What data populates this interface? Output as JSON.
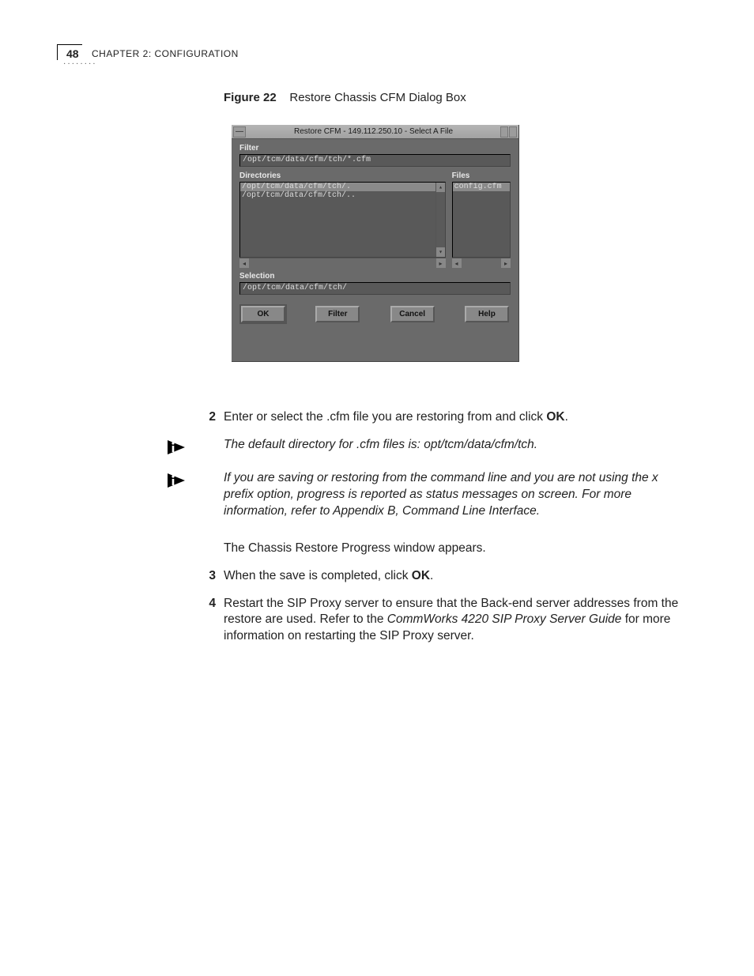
{
  "header": {
    "page_number": "48",
    "chapter_text": "CHAPTER 2: CONFIGURATION"
  },
  "figure": {
    "label": "Figure 22",
    "caption": "Restore Chassis CFM Dialog Box"
  },
  "dialog": {
    "title": "Restore CFM - 149.112.250.10 - Select A File",
    "filter_label": "Filter",
    "filter_value": "/opt/tcm/data/cfm/tch/*.cfm",
    "directories_label": "Directories",
    "directories": [
      "/opt/tcm/data/cfm/tch/.",
      "/opt/tcm/data/cfm/tch/.."
    ],
    "files_label": "Files",
    "files": [
      "config.cfm"
    ],
    "selection_label": "Selection",
    "selection_value": "/opt/tcm/data/cfm/tch/",
    "buttons": {
      "ok": "OK",
      "filter": "Filter",
      "cancel": "Cancel",
      "help": "Help"
    }
  },
  "steps": {
    "s2_num": "2",
    "s2_pre": "Enter or select the .cfm file you are restoring from and click ",
    "s2_bold": "OK",
    "s2_post": ".",
    "note1": "The default directory for .cfm files is: opt/tcm/data/cfm/tch.",
    "note2": "If you are saving or restoring from the command line and you are not using the x prefix option, progress is reported as status messages on screen. For more information, refer to Appendix B, Command Line Interface.",
    "progress": "The Chassis Restore Progress window appears.",
    "s3_num": "3",
    "s3_pre": "When the save is completed, click ",
    "s3_bold": "OK",
    "s3_post": ".",
    "s4_num": "4",
    "s4_pre": "Restart the SIP Proxy server to ensure that the Back-end server addresses from the restore are used. Refer to the ",
    "s4_italic": "CommWorks 4220 SIP Proxy Server Guide",
    "s4_post": " for more information on restarting the SIP Proxy server."
  }
}
